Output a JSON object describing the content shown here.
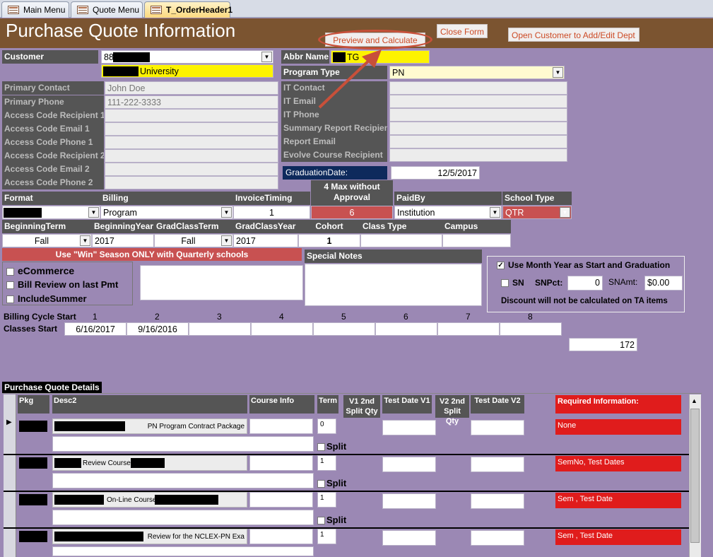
{
  "tabs": [
    {
      "label": "Main Menu"
    },
    {
      "label": "Quote Menu"
    },
    {
      "label": "T_OrderHeader1"
    }
  ],
  "header": {
    "title": "Purchase Quote Information",
    "preview_label": "Preview and Calculate",
    "close_label": "Close Form",
    "open_customer_label": "Open Customer to Add/Edit Dept"
  },
  "left": {
    "customer_label": "Customer",
    "customer_value": "88",
    "university_value": "University",
    "primary_contact_label": "Primary Contact",
    "primary_contact_value": "John Doe",
    "primary_phone_label": "Primary Phone",
    "primary_phone_value": "111-222-3333",
    "acr1_label": "Access Code Recipient 1",
    "ace1_label": "Access Code Email 1",
    "acp1_label": "Access Code Phone 1",
    "acr2_label": "Access Code Recipient 2",
    "ace2_label": "Access Code Email 2",
    "acp2_label": "Access Code Phone 2"
  },
  "right": {
    "abbr_label": "Abbr Name",
    "abbr_value": "TG",
    "program_type_label": "Program Type",
    "program_type_value": "PN",
    "it_contact_label": "IT Contact",
    "it_email_label": "IT Email",
    "it_phone_label": "IT Phone",
    "summary_label": "Summary Report Recipient",
    "report_email_label": "Report Email",
    "evolve_label": "Evolve Course Recipient",
    "grad_label": "GraduationDate:",
    "grad_value": "12/5/2017"
  },
  "row1": {
    "format_label": "Format",
    "billing_label": "Billing",
    "billing_value": "Program",
    "invoice_label": "InvoiceTiming",
    "invoice_value": "1",
    "max_label": "4 Max  without Approval",
    "max_value": "6",
    "paidby_label": "PaidBy",
    "paidby_value": "Institution",
    "schooltype_label": "School Type",
    "schooltype_value": "QTR"
  },
  "row2": {
    "bterm_label": "BeginningTerm",
    "bterm_value": "Fall",
    "byear_label": "BeginningYear",
    "byear_value": "2017",
    "gterm_label": "GradClassTerm",
    "gterm_value": "Fall",
    "gyear_label": "GradClassYear",
    "gyear_value": "2017",
    "cohort_label": "Cohort",
    "cohort_value": "1",
    "classtype_label": "Class Type",
    "campus_label": "Campus"
  },
  "win_notice": "Use \"Win\"  Season ONLY with Quarterly schools",
  "special_notes_label": "Special Notes",
  "checks": {
    "ecommerce": "eCommerce",
    "bill_review": "Bill Review on last Pmt",
    "include_summer": "IncludeSummer"
  },
  "sn": {
    "use_month": "Use Month Year as Start and Graduation",
    "sn_label": "SN",
    "snpct_label": "SNPct:",
    "snpct_value": "0",
    "snamt_label": "SNAmt:",
    "snamt_value": "$0.00",
    "discount_note": "Discount will not be calculated on TA items"
  },
  "billing_cycle": {
    "label": "Billing Cycle Start",
    "classes_label": "Classes Start",
    "nums": [
      "1",
      "2",
      "3",
      "4",
      "5",
      "6",
      "7",
      "8"
    ],
    "dates": [
      "6/16/2017",
      "9/16/2016",
      "",
      "",
      "",
      "",
      "",
      ""
    ],
    "total": "172"
  },
  "details": {
    "title": "Purchase Quote Details",
    "headers": {
      "pkg": "Pkg",
      "desc2": "Desc2",
      "course_info": "Course Info",
      "term": "Term",
      "v1_split": "V1 2nd Split Qty",
      "test_v1": "Test Date V1",
      "v2_split": "V2 2nd Split Qty",
      "test_v2": "Test Date V2",
      "required": "Required Information:"
    },
    "split_label": "Split",
    "rows": [
      {
        "desc": "PN Program Contract Package",
        "term": "0",
        "required": "None"
      },
      {
        "desc": "Review Course",
        "term": "1",
        "required": "SemNo, Test Dates"
      },
      {
        "desc": "On-Line Course",
        "term": "1",
        "required": "Sem , Test Date"
      },
      {
        "desc": "Review for the NCLEX-PN Exa",
        "term": "1",
        "required": "Sem , Test Date"
      }
    ]
  },
  "colors": {
    "bg": "#9b88b4",
    "header": "#7b5430",
    "label": "#555555",
    "yellow": "#fdf300",
    "red": "#c85151",
    "req_red": "#e01c1c"
  }
}
